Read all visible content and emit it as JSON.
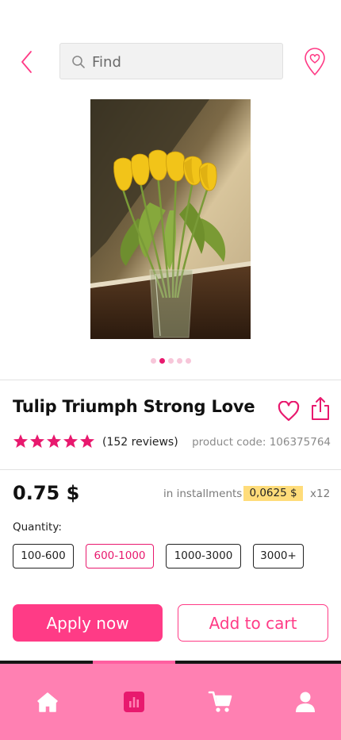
{
  "header": {
    "search_placeholder": "Find",
    "icons": [
      "chevron-left-icon",
      "search-icon",
      "location-heart-icon"
    ]
  },
  "gallery": {
    "image": "yellow-tulips-in-vase",
    "total": 5,
    "active_index": 1
  },
  "product": {
    "title": "Tulip Triumph Strong Love",
    "rating": 5,
    "reviews": "(152 reviews)",
    "code": "product code: 106375764",
    "price": "0.75 $",
    "installments_label": "in installments",
    "installments_value": "0,0625 $",
    "installments_count": "x12"
  },
  "quantity": {
    "label": "Quantity:",
    "options": [
      {
        "label": "100-600",
        "selected": false
      },
      {
        "label": "600-1000",
        "selected": true
      },
      {
        "label": "1000-3000",
        "selected": false
      },
      {
        "label": "3000+",
        "selected": false
      }
    ]
  },
  "actions": {
    "apply": "Apply now",
    "add_to_cart": "Add to cart"
  },
  "nav": {
    "items": [
      "home-icon",
      "stats-icon",
      "cart-icon",
      "profile-icon"
    ],
    "active": "stats-icon"
  },
  "colors": {
    "accent": "#ff3b86",
    "accent_dark": "#e8196e",
    "nav_bg": "#ff80b2",
    "highlight": "#ffdc7a"
  }
}
